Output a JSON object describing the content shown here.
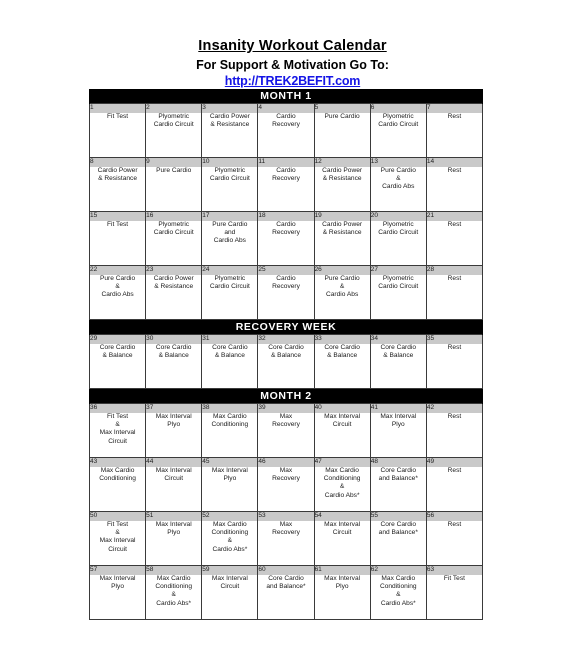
{
  "header": {
    "title": "Insanity Workout Calendar",
    "subtitle": "For Support & Motivation Go To:",
    "link_text": "http://TREK2BEFIT.com",
    "link_color": "#1414e6"
  },
  "theme": {
    "band_bg": "#000000",
    "band_fg": "#ffffff",
    "daynum_bg": "#c9c9c9",
    "cell_bg": "#ffffff",
    "border": "#3a3a3a"
  },
  "calendar": {
    "sections": [
      {
        "band": "MONTH 1",
        "weeks": [
          {
            "days": [
              "1",
              "2",
              "3",
              "4",
              "5",
              "6",
              "7"
            ],
            "workouts": [
              "Fit Test",
              "Plyometric\nCardio Circuit",
              "Cardio Power\n& Resistance",
              "Cardio\nRecovery",
              "Pure Cardio",
              "Plyometric\nCardio Circuit",
              "Rest"
            ]
          },
          {
            "days": [
              "8",
              "9",
              "10",
              "11",
              "12",
              "13",
              "14"
            ],
            "workouts": [
              "Cardio Power\n& Resistance",
              "Pure Cardio",
              "Plyometric\nCardio Circuit",
              "Cardio\nRecovery",
              "Cardio Power\n& Resistance",
              "Pure Cardio\n&\nCardio Abs",
              "Rest"
            ]
          },
          {
            "days": [
              "15",
              "16",
              "17",
              "18",
              "19",
              "20",
              "21"
            ],
            "workouts": [
              "Fit Test",
              "Plyometric\nCardio Circuit",
              "Pure Cardio\nand\nCardio Abs",
              "Cardio\nRecovery",
              "Cardio Power\n& Resistance",
              "Plyometric\nCardio Circuit",
              "Rest"
            ]
          },
          {
            "days": [
              "22",
              "23",
              "24",
              "25",
              "26",
              "27",
              "28"
            ],
            "workouts": [
              "Pure Cardio\n&\nCardio Abs",
              "Cardio Power\n& Resistance",
              "Plyometric\nCardio Circuit",
              "Cardio\nRecovery",
              "Pure Cardio\n&\nCardio Abs",
              "Plyometric\nCardio Circuit",
              "Rest"
            ]
          }
        ]
      },
      {
        "band": "RECOVERY WEEK",
        "weeks": [
          {
            "days": [
              "29",
              "30",
              "31",
              "32",
              "33",
              "34",
              "35"
            ],
            "workouts": [
              "Core Cardio\n& Balance",
              "Core Cardio\n& Balance",
              "Core Cardio\n& Balance",
              "Core Cardio\n& Balance",
              "Core Cardio\n& Balance",
              "Core Cardio\n& Balance",
              "Rest"
            ]
          }
        ]
      },
      {
        "band": "MONTH 2",
        "weeks": [
          {
            "days": [
              "36",
              "37",
              "38",
              "39",
              "40",
              "41",
              "42"
            ],
            "workouts": [
              "Fit Test\n&\nMax Interval\nCircuit",
              "Max Interval\nPlyo",
              "Max Cardio\nConditioning",
              "Max\nRecovery",
              "Max Interval\nCircuit",
              "Max Interval\nPlyo",
              "Rest"
            ]
          },
          {
            "days": [
              "43",
              "44",
              "45",
              "46",
              "47",
              "48",
              "49"
            ],
            "workouts": [
              "Max Cardio\nConditioning",
              "Max Interval\nCircuit",
              "Max Interval\nPlyo",
              "Max\nRecovery",
              "Max Cardio\nConditioning\n&\nCardio Abs*",
              "Core Cardio\nand Balance*",
              "Rest"
            ]
          },
          {
            "days": [
              "50",
              "51",
              "52",
              "53",
              "54",
              "55",
              "56"
            ],
            "workouts": [
              "Fit Test\n&\nMax Interval\nCircuit",
              "Max Interval\nPlyo",
              "Max Cardio\nConditioning\n&\nCardio Abs*",
              "Max\nRecovery",
              "Max Interval\nCircuit",
              "Core Cardio\nand Balance*",
              "Rest"
            ]
          },
          {
            "days": [
              "57",
              "58",
              "59",
              "60",
              "61",
              "62",
              "63"
            ],
            "workouts": [
              "Max Interval\nPlyo",
              "Max Cardio\nConditioning\n&\nCardio Abs*",
              "Max Interval\nCircuit",
              "Core Cardio\nand Balance*",
              "Max Interval\nPlyo",
              "Max Cardio\nConditioning\n&\nCardio Abs*",
              "Fit Test"
            ]
          }
        ]
      }
    ]
  }
}
